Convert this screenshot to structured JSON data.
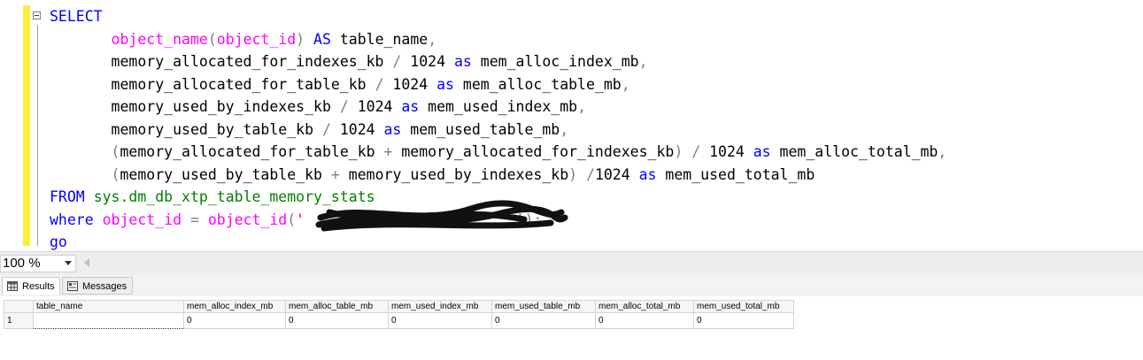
{
  "editor": {
    "lines": [
      [
        {
          "t": "SELECT",
          "c": "kw"
        }
      ],
      [
        {
          "t": "       "
        },
        {
          "t": "object_name",
          "c": "fn"
        },
        {
          "t": "(",
          "c": "op"
        },
        {
          "t": "object_id",
          "c": "fn"
        },
        {
          "t": ")",
          "c": "op"
        },
        {
          "t": " "
        },
        {
          "t": "AS",
          "c": "kw"
        },
        {
          "t": " table_name"
        },
        {
          "t": ",",
          "c": "op"
        }
      ],
      [
        {
          "t": "       memory_allocated_for_indexes_kb "
        },
        {
          "t": "/",
          "c": "op"
        },
        {
          "t": " 1024 "
        },
        {
          "t": "as",
          "c": "kw"
        },
        {
          "t": " mem_alloc_index_mb"
        },
        {
          "t": ",",
          "c": "op"
        }
      ],
      [
        {
          "t": "       memory_allocated_for_table_kb "
        },
        {
          "t": "/",
          "c": "op"
        },
        {
          "t": " 1024 "
        },
        {
          "t": "as",
          "c": "kw"
        },
        {
          "t": " mem_alloc_table_mb"
        },
        {
          "t": ",",
          "c": "op"
        }
      ],
      [
        {
          "t": "       memory_used_by_indexes_kb "
        },
        {
          "t": "/",
          "c": "op"
        },
        {
          "t": " 1024 "
        },
        {
          "t": "as",
          "c": "kw"
        },
        {
          "t": " mem_used_index_mb"
        },
        {
          "t": ",",
          "c": "op"
        }
      ],
      [
        {
          "t": "       memory_used_by_table_kb "
        },
        {
          "t": "/",
          "c": "op"
        },
        {
          "t": " 1024 "
        },
        {
          "t": "as",
          "c": "kw"
        },
        {
          "t": " mem_used_table_mb"
        },
        {
          "t": ",",
          "c": "op"
        }
      ],
      [
        {
          "t": "       "
        },
        {
          "t": "(",
          "c": "op"
        },
        {
          "t": "memory_allocated_for_table_kb "
        },
        {
          "t": "+",
          "c": "op"
        },
        {
          "t": " memory_allocated_for_indexes_kb"
        },
        {
          "t": ")",
          "c": "op"
        },
        {
          "t": " "
        },
        {
          "t": "/",
          "c": "op"
        },
        {
          "t": " 1024 "
        },
        {
          "t": "as",
          "c": "kw"
        },
        {
          "t": " mem_alloc_total_mb"
        },
        {
          "t": ",",
          "c": "op"
        }
      ],
      [
        {
          "t": "       "
        },
        {
          "t": "(",
          "c": "op"
        },
        {
          "t": "memory_used_by_table_kb "
        },
        {
          "t": "+",
          "c": "op"
        },
        {
          "t": " memory_used_by_indexes_kb"
        },
        {
          "t": ")",
          "c": "op"
        },
        {
          "t": " "
        },
        {
          "t": "/",
          "c": "op"
        },
        {
          "t": "1024 "
        },
        {
          "t": "as",
          "c": "kw"
        },
        {
          "t": " mem_used_total_mb"
        }
      ],
      [
        {
          "t": "FROM",
          "c": "kw"
        },
        {
          "t": " "
        },
        {
          "t": "sys.dm_db_xtp_table_memory_stats",
          "c": "sys"
        }
      ],
      [
        {
          "t": "where",
          "c": "kw"
        },
        {
          "t": " "
        },
        {
          "t": "object_id",
          "c": "fn"
        },
        {
          "t": " "
        },
        {
          "t": "=",
          "c": "op"
        },
        {
          "t": " "
        },
        {
          "t": "object_id",
          "c": "fn"
        },
        {
          "t": "(",
          "c": "op"
        },
        {
          "t": "'",
          "c": "str"
        },
        {
          "t": "                        "
        },
        {
          "t": "'",
          "c": "str"
        },
        {
          "t": ");",
          "c": "op"
        }
      ],
      [
        {
          "t": "go",
          "c": "kw"
        }
      ]
    ]
  },
  "status_bar": {
    "zoom_value": "100 %"
  },
  "result_tabs": {
    "results": "Results",
    "messages": "Messages"
  },
  "results_grid": {
    "columns": [
      "table_name",
      "mem_alloc_index_mb",
      "mem_alloc_table_mb",
      "mem_used_index_mb",
      "mem_used_table_mb",
      "mem_alloc_total_mb",
      "mem_used_total_mb"
    ],
    "rows": [
      {
        "row_number": "1",
        "cells": [
          "",
          "0",
          "0",
          "0",
          "0",
          "0",
          "0"
        ]
      }
    ]
  },
  "icons": {
    "fold": "collapse-minus-icon",
    "zoom_dropdown": "chevron-down-icon",
    "results_tab": "grid-icon",
    "messages_tab": "messages-icon"
  },
  "colors": {
    "keyword": "#0000ff",
    "function": "#ff00ff",
    "system_object": "#008000",
    "operator": "#808080",
    "string": "#ff0000",
    "change_bar": "#fcef3a"
  }
}
